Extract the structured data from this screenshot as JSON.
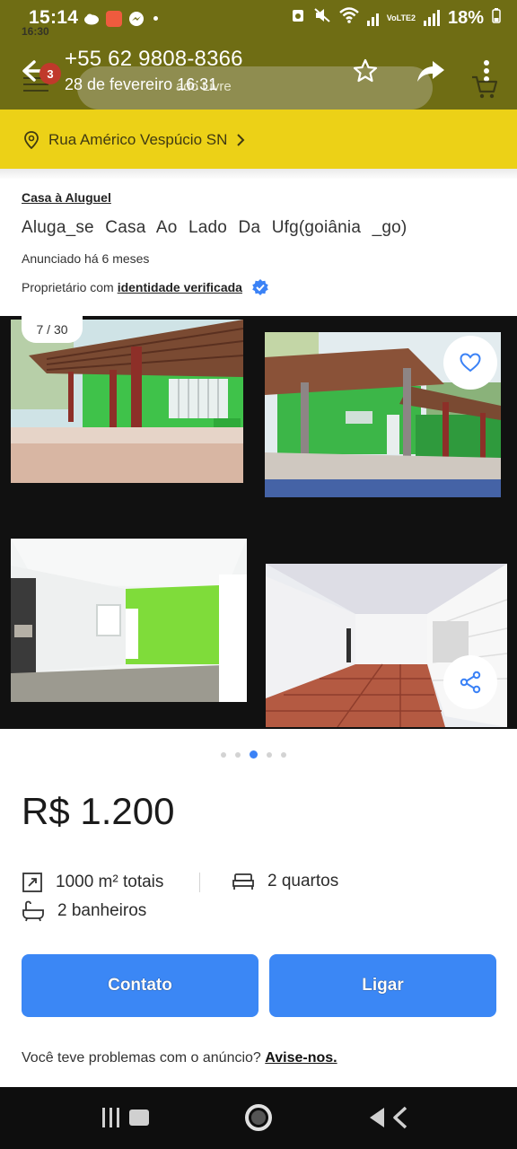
{
  "status_bar": {
    "time": "15:14",
    "ghost_time": "16:30",
    "battery": "18%",
    "network": "VoLTE2"
  },
  "app_bar": {
    "phone_number": "+55 62 9808-8366",
    "date": "28 de fevereiro 16:31",
    "search_placeholder": "ado Livre",
    "badge_count": "3"
  },
  "address": {
    "text": "Rua Américo Vespúcio SN"
  },
  "listing": {
    "category": "Casa à Aluguel",
    "title": "Aluga_se Casa Ao Lado Da Ufg(goiânia _go)",
    "posted": "Anunciado há 6 meses",
    "owner_prefix": "Proprietário com",
    "owner_verified": "identidade verificada"
  },
  "gallery": {
    "counter": "7 / 30",
    "dot_count": 5,
    "active_dot": 2
  },
  "price": "R$ 1.200",
  "features": {
    "area": "1000 m² totais",
    "rooms": "2 quartos",
    "bathrooms": "2 banheiros"
  },
  "actions": {
    "contact": "Contato",
    "call": "Ligar"
  },
  "report": {
    "question": "Você teve problemas com o anúncio?",
    "link": "Avise-nos."
  },
  "colors": {
    "topbar": "#6f6d14",
    "address_bar": "#ecd117",
    "accent_blue": "#3b87f5",
    "verified_blue": "#3b82f6"
  }
}
